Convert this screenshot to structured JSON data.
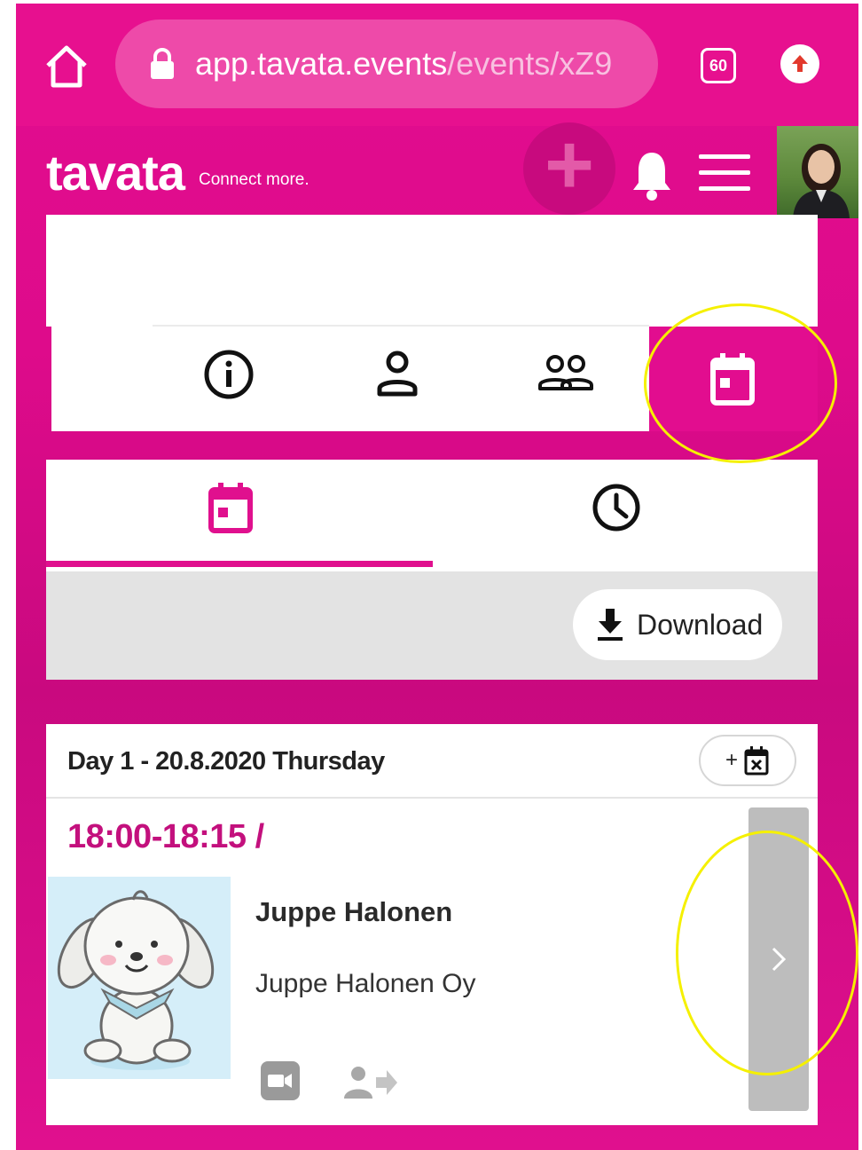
{
  "browser": {
    "url_host": "app.tavata.events",
    "url_path": "/events/xZ9",
    "tabs_count": "60"
  },
  "app": {
    "logo": "tavata",
    "tagline": "Connect more."
  },
  "agenda": {
    "download_label": "Download",
    "add_calendar_label": "+",
    "day_title": "Day 1 - 20.8.2020 Thursday",
    "session": {
      "time": "18:00-18:15 /",
      "speaker_name": "Juppe Halonen",
      "speaker_company": "Juppe Halonen Oy"
    }
  },
  "colors": {
    "brand": "#e20d8f",
    "time_text": "#c3107d",
    "highlight": "#f5f000"
  }
}
